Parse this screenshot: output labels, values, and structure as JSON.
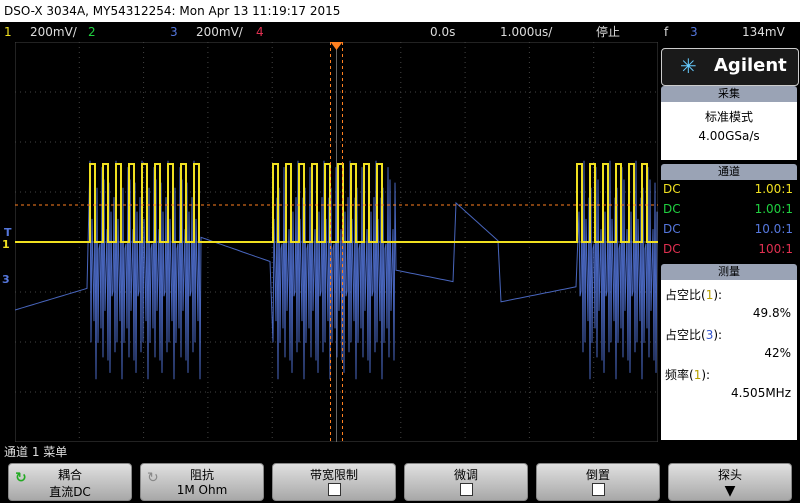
{
  "title": "DSO-X 3034A, MY54312254: Mon Apr 13 11:19:17 2015",
  "status": {
    "ch1_num": "1",
    "ch1_scale": "200mV/",
    "ch2_num": "2",
    "ch3_num": "3",
    "ch3_scale": "200mV/",
    "ch4_num": "4",
    "delay": "0.0s",
    "timebase": "1.000us/",
    "run_state": "停止",
    "trigger_symbol": "f",
    "trigger_channel": "3",
    "trigger_level": "134mV"
  },
  "colors": {
    "ch1": "#f0e020",
    "ch2": "#20d040",
    "ch3": "#5577dd",
    "ch4": "#e03050",
    "cursor": "#ff8020"
  },
  "brand": "Agilent",
  "acquisition": {
    "header": "采集",
    "mode": "标准模式",
    "rate": "4.00GSa/s"
  },
  "channels": {
    "header": "通道",
    "rows": [
      {
        "coupling": "DC",
        "probe": "1.00:1"
      },
      {
        "coupling": "DC",
        "probe": "1.00:1"
      },
      {
        "coupling": "DC",
        "probe": "10.0:1"
      },
      {
        "coupling": "DC",
        "probe": "100:1"
      }
    ]
  },
  "measurements": {
    "header": "测量",
    "items": [
      {
        "label_pre": "占空比(",
        "ch": "1",
        "label_post": "):",
        "value": "49.8%"
      },
      {
        "label_pre": "占空比(",
        "ch": "3",
        "label_post": "):",
        "value": "42%"
      },
      {
        "label_pre": "频率(",
        "ch": "1",
        "label_post": "):",
        "value": "4.505MHz"
      }
    ]
  },
  "menu_title": "通道 1 菜单",
  "softkeys": [
    {
      "l1": "耦合",
      "l2": "直流DC"
    },
    {
      "l1": "阻抗",
      "l2": "1M Ohm"
    },
    {
      "l1": "带宽限制",
      "l2": ""
    },
    {
      "l1": "微调",
      "l2": ""
    },
    {
      "l1": "倒置",
      "l2": ""
    },
    {
      "l1": "探头",
      "l2": ""
    }
  ],
  "markers": {
    "ch1": "1",
    "ch3": "3",
    "trig": "T"
  }
}
